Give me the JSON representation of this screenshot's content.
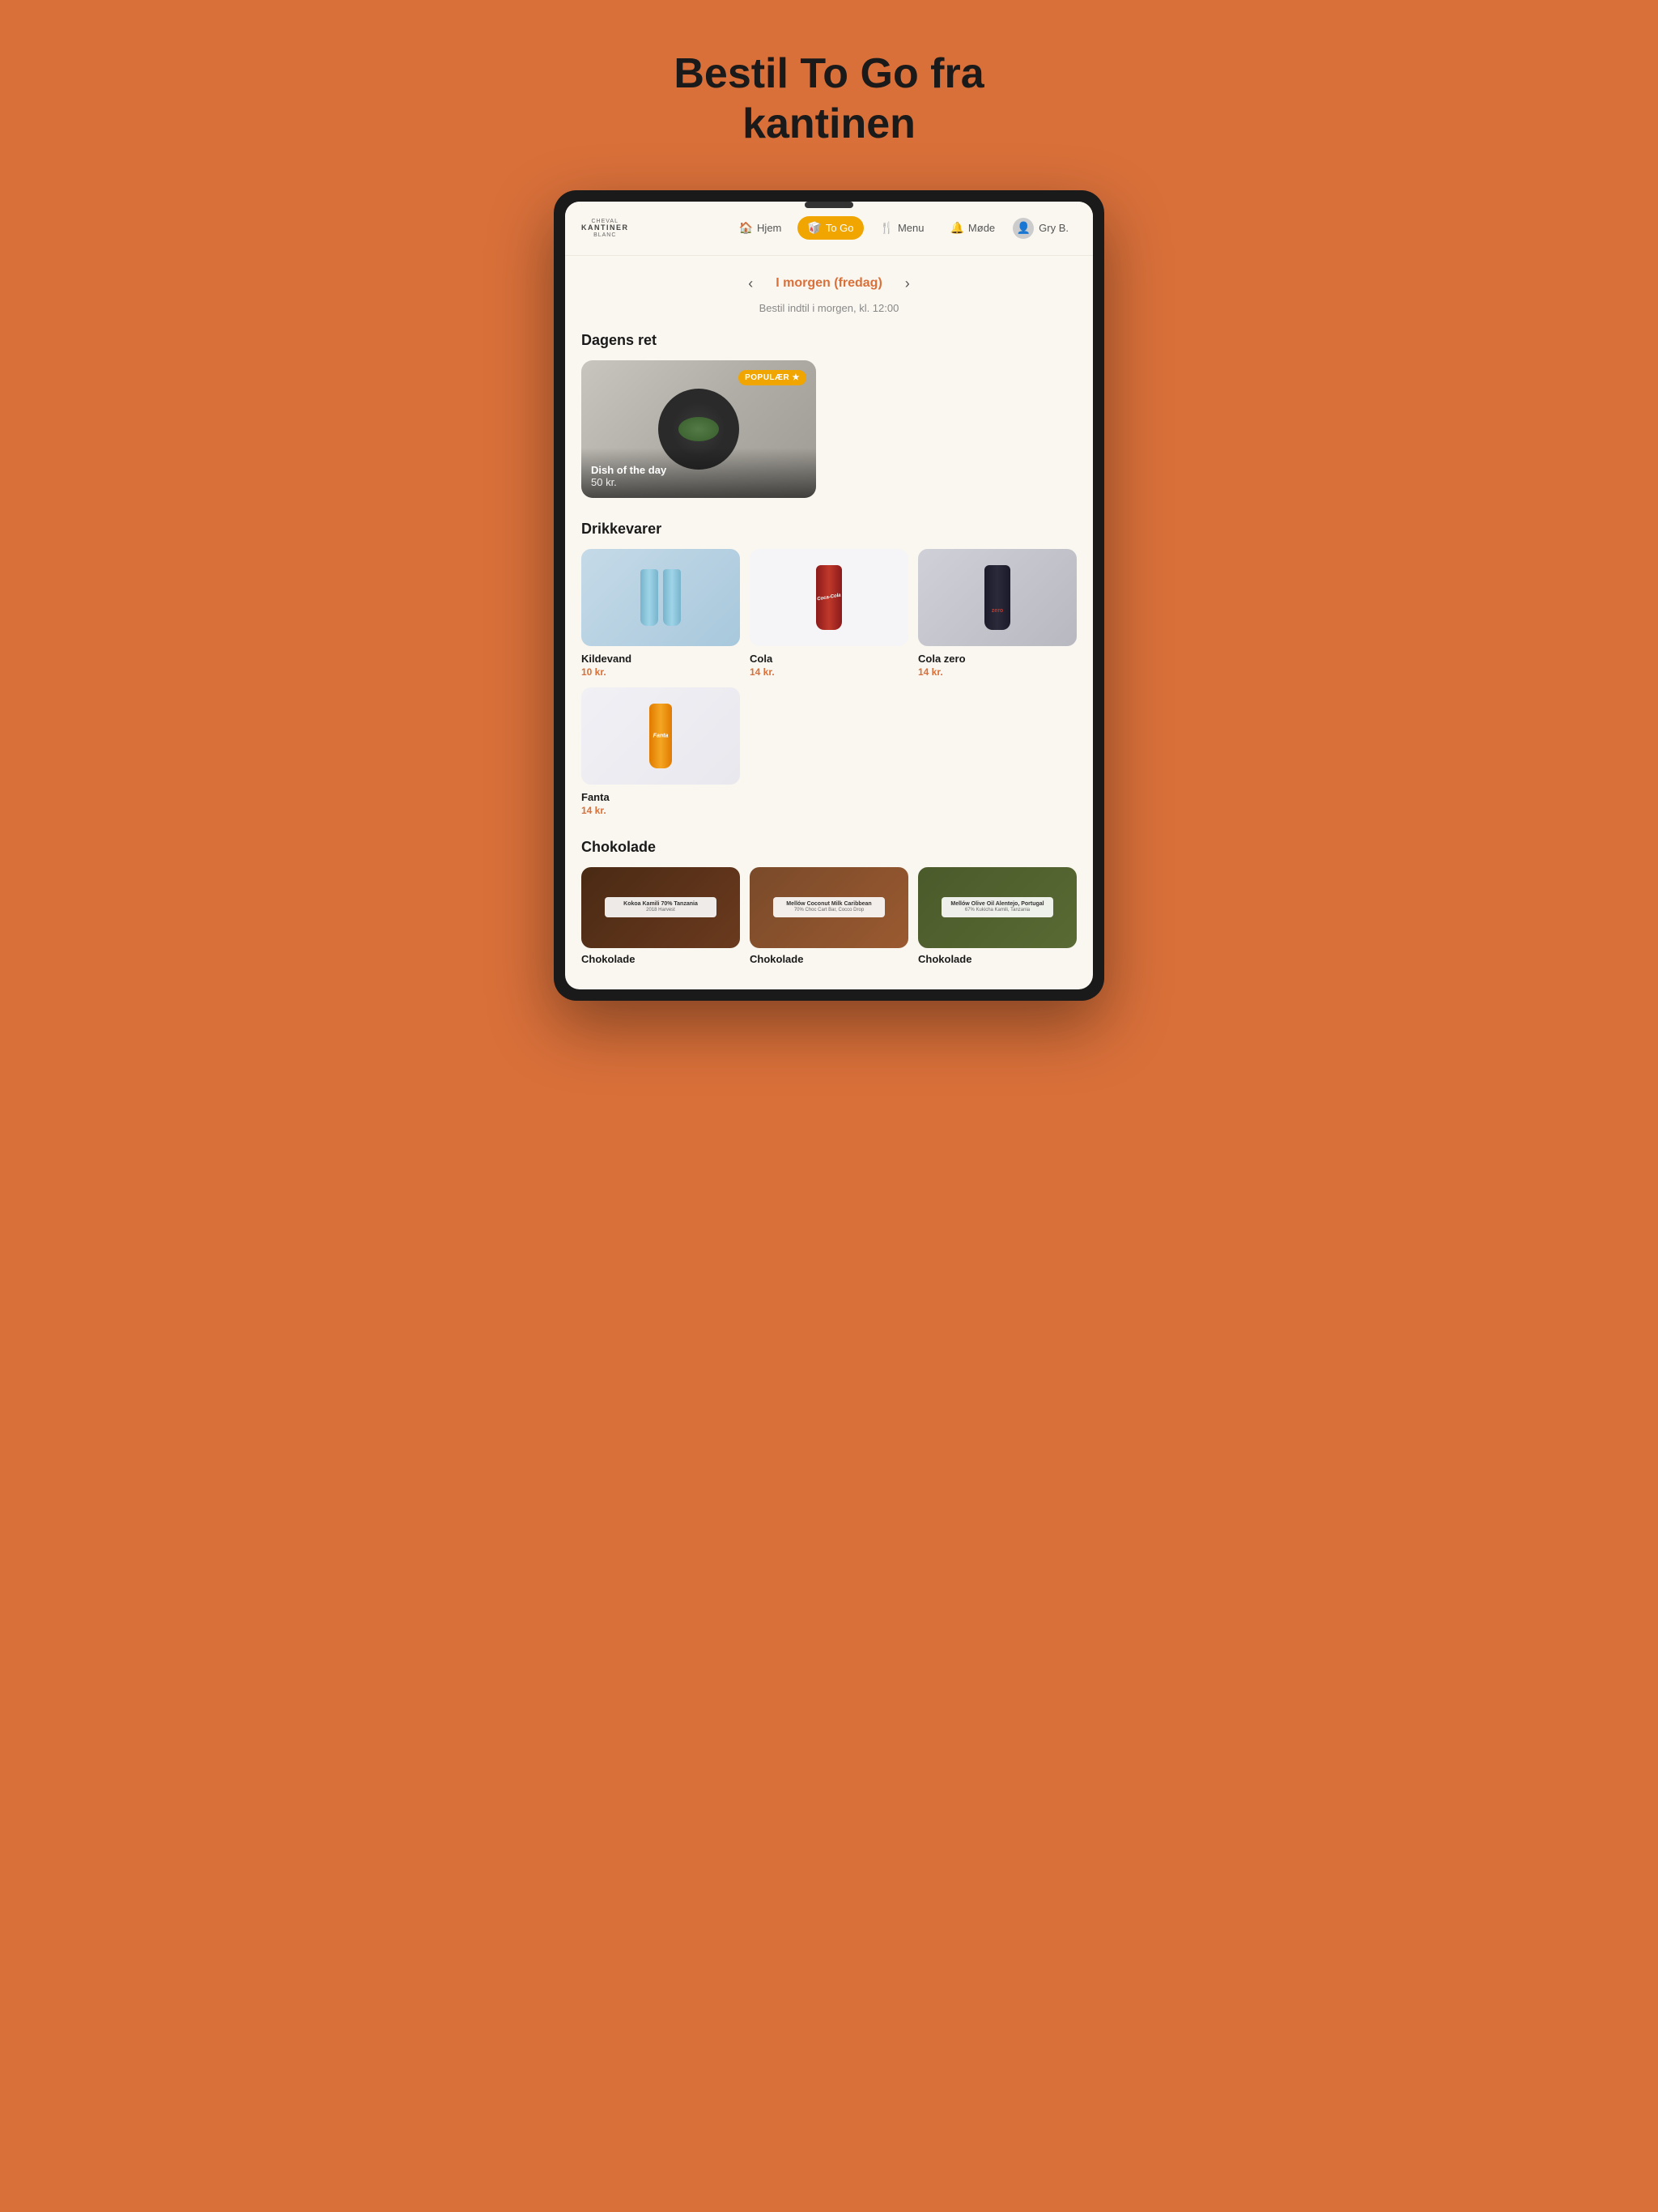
{
  "hero": {
    "title": "Bestil To Go fra kantinen"
  },
  "nav": {
    "logo_line1": "CHEVAL",
    "logo_line2": "KANTINER",
    "logo_line3": "BLANC",
    "links": [
      {
        "label": "Hjem",
        "icon": "🏠",
        "active": false
      },
      {
        "label": "To Go",
        "icon": "🥡",
        "active": true
      },
      {
        "label": "Menu",
        "icon": "🍴",
        "active": false
      },
      {
        "label": "Møde",
        "icon": "🔔",
        "active": false
      }
    ],
    "user_label": "Gry B.",
    "user_icon": "👤"
  },
  "date_nav": {
    "prev_label": "‹",
    "next_label": "›",
    "date_label": "I morgen (fredag)",
    "sublabel": "Bestil indtil i morgen, kl. 12:00"
  },
  "sections": {
    "dagens_ret": {
      "title": "Dagens ret",
      "item": {
        "name": "Dish of the day",
        "price": "50 kr.",
        "badge": "POPULÆR ★"
      }
    },
    "drikkevarer": {
      "title": "Drikkevarer",
      "items": [
        {
          "name": "Kildevand",
          "price": "10 kr."
        },
        {
          "name": "Cola",
          "price": "14 kr."
        },
        {
          "name": "Cola zero",
          "price": "14 kr."
        },
        {
          "name": "Fanta",
          "price": "14 kr."
        }
      ]
    },
    "chokolade": {
      "title": "Chokolade",
      "items": [
        {
          "name": "Chokolade",
          "price": "",
          "label_title": "Kokoa Kamili 70% Tanzania",
          "label_sub": "2018 Harvest"
        },
        {
          "name": "Chokolade",
          "price": "",
          "label_title": "Mellów Coconut Milk Caribbean",
          "label_sub": "70% Choc Cart Bar, Cocco Drop"
        },
        {
          "name": "Chokolade",
          "price": "",
          "label_title": "Mellów Olive Oil Alentejo, Portugal",
          "label_sub": "67% Kukicha Kamili, Tanzania"
        }
      ]
    }
  },
  "colors": {
    "accent_orange": "#D9703A",
    "amber": "#F0A500",
    "bg_cream": "#faf7f0"
  }
}
